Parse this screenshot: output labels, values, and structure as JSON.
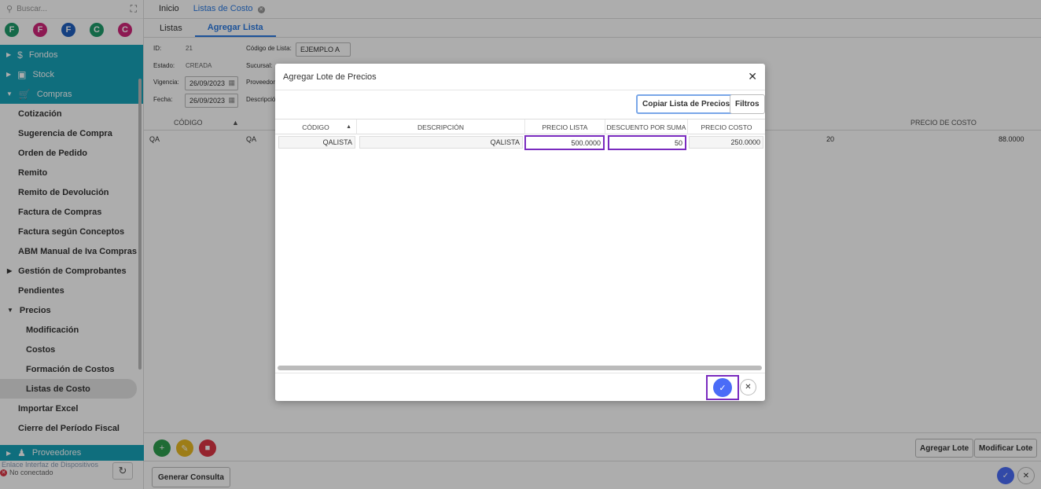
{
  "sidebar": {
    "search_placeholder": "Buscar...",
    "avatars": [
      {
        "letter": "F",
        "color": "#1e9b6b"
      },
      {
        "letter": "F",
        "color": "#d0267a"
      },
      {
        "letter": "F",
        "color": "#1f5fbf"
      },
      {
        "letter": "C",
        "color": "#1e9b6b"
      },
      {
        "letter": "C",
        "color": "#d0267a"
      }
    ],
    "groups": {
      "fondos": "Fondos",
      "stock": "Stock",
      "compras": "Compras",
      "proveedores": "Proveedores"
    },
    "items": {
      "cotizacion": "Cotización",
      "sugerencia": "Sugerencia de Compra",
      "orden": "Orden de Pedido",
      "remito": "Remito",
      "remito_dev": "Remito de Devolución",
      "factura": "Factura de Compras",
      "factura_conceptos": "Factura según Conceptos",
      "abm_iva": "ABM Manual de Iva Compras",
      "gestion": "Gestión de Comprobantes",
      "pendientes": "Pendientes",
      "precios": "Precios",
      "modificacion": "Modificación",
      "costos": "Costos",
      "formacion": "Formación de Costos",
      "listas": "Listas de Costo",
      "importar": "Importar Excel",
      "cierre": "Cierre del Período Fiscal"
    },
    "device_link": "Enlace Interfaz de Dispositivos",
    "device_status": "No conectado"
  },
  "tabs": {
    "inicio": "Inicio",
    "listas_costo": "Listas de Costo"
  },
  "subtabs": {
    "listas": "Listas",
    "agregar": "Agregar Lista"
  },
  "form": {
    "id_label": "ID:",
    "id_value": "21",
    "codigo_label": "Código de Lista:",
    "codigo_value": "EJEMPLO A",
    "estado_label": "Estado:",
    "estado_value": "CREADA",
    "sucursal_label": "Sucursal:",
    "vigencia_label": "Vigencia:",
    "vigencia_value": "26/09/2023",
    "proveedor_label": "Proveedor:",
    "fecha_label": "Fecha:",
    "fecha_value": "26/09/2023",
    "descripcion_label": "Descripción:"
  },
  "bg_table": {
    "col_codigo": "CÓDIGO",
    "col_precio_costo": "PRECIO DE COSTO",
    "row": {
      "codigo": "QA",
      "desc": "QA",
      "desc_val": "20",
      "costo": "88.0000"
    }
  },
  "bottom": {
    "agregar_lote": "Agregar Lote",
    "modificar_lote": "Modificar Lote",
    "generar_consulta": "Generar Consulta"
  },
  "modal": {
    "title": "Agregar Lote de Precios",
    "copiar_btn": "Copiar Lista de Precios",
    "filtros_btn": "Filtros",
    "columns": [
      "CÓDIGO",
      "DESCRIPCIÓN",
      "PRECIO LISTA",
      "DESCUENTO POR SUMA",
      "PRECIO COSTO"
    ],
    "row": {
      "codigo": "QALISTA",
      "descripcion": "QALISTA",
      "precio_lista": "500.0000",
      "descuento": "50",
      "precio_costo": "250.0000"
    }
  }
}
